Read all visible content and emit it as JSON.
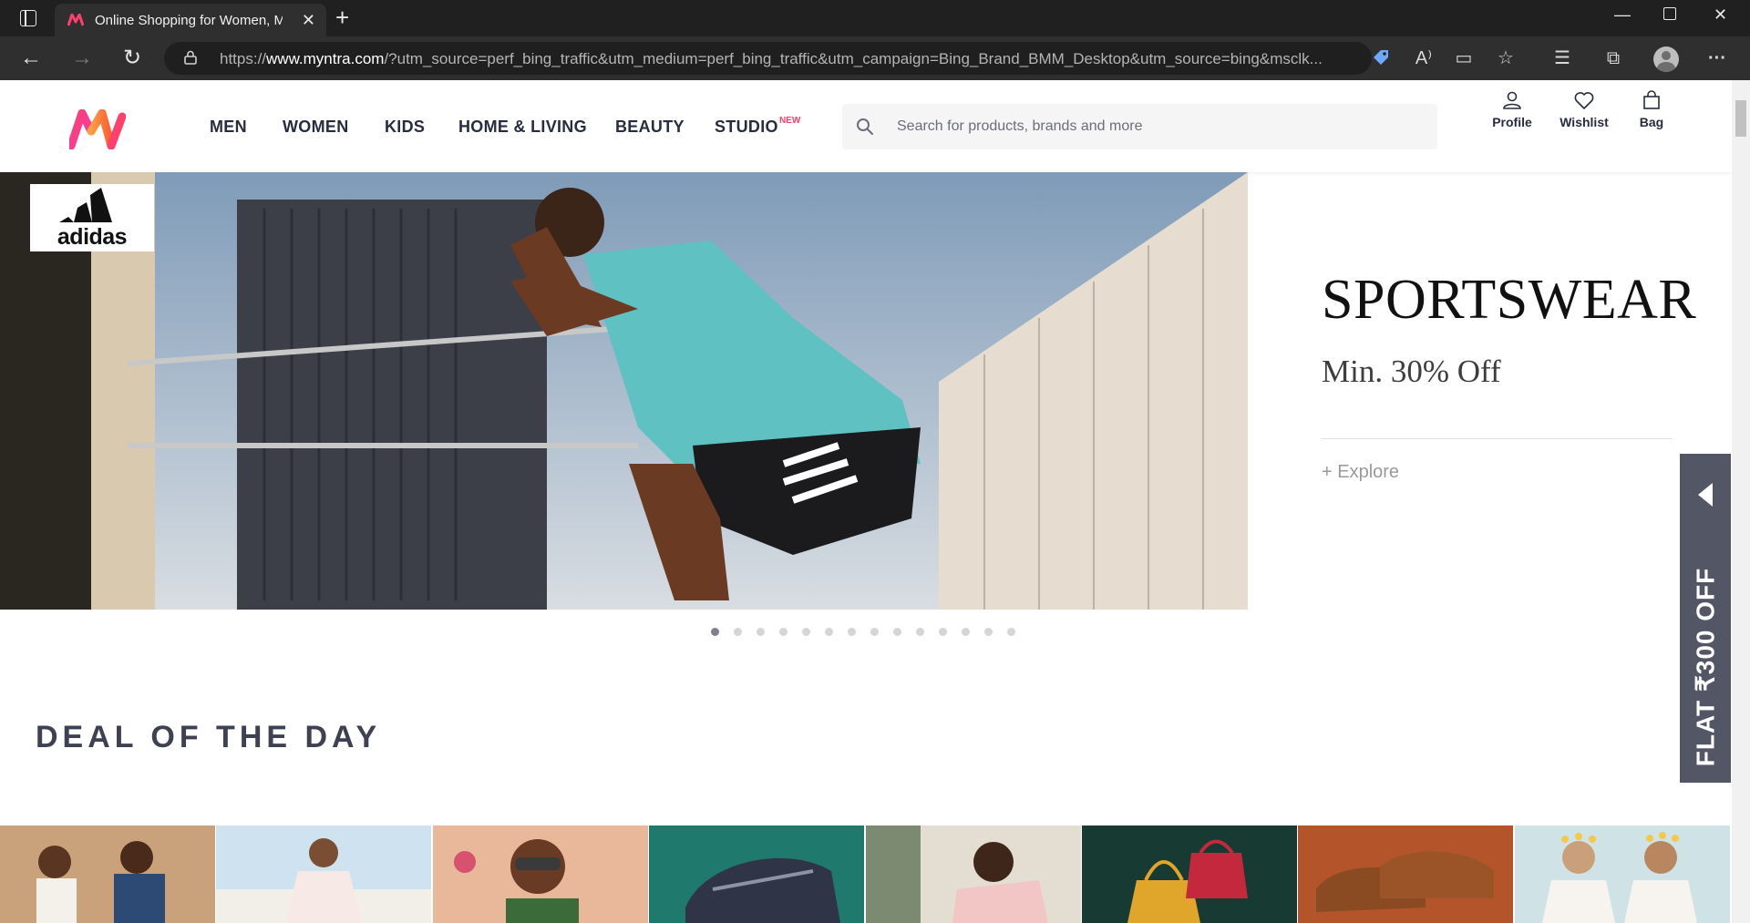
{
  "browser": {
    "tab_title": "Online Shopping for Women, Men",
    "url_prefix": "https://",
    "url_host": "www.myntra.com",
    "url_rest": "/?utm_source=perf_bing_traffic&utm_medium=perf_bing_traffic&utm_campaign=Bing_Brand_BMM_Desktop&utm_source=bing&msclk...",
    "icons": [
      "sidebar-icon",
      "close-icon",
      "plus-icon",
      "minimize-icon",
      "maximize-icon",
      "back-icon",
      "forward-icon",
      "refresh-icon",
      "lock-icon",
      "tag-icon",
      "read-aloud-icon",
      "immersive-reader-icon",
      "favorite-add-icon",
      "favorites-icon",
      "collections-icon",
      "profile-icon",
      "more-icon"
    ]
  },
  "header": {
    "nav": [
      "MEN",
      "WOMEN",
      "KIDS",
      "HOME & LIVING",
      "BEAUTY",
      "STUDIO"
    ],
    "studio_badge": "NEW",
    "search_placeholder": "Search for products, brands and more",
    "actions": [
      "Profile",
      "Wishlist",
      "Bag"
    ]
  },
  "hero": {
    "brand": "adidas",
    "title": "SPORTSWEAR",
    "subtitle": "Min. 30% Off",
    "cta": "+ Explore",
    "slide_count": 14,
    "active_slide": 1
  },
  "offer_tab": {
    "label": "FLAT ₹300 OFF"
  },
  "deals": {
    "title": "DEAL OF THE DAY",
    "card_count": 8
  },
  "colors": {
    "accent": "#ff3f6c",
    "nav_text": "#282c3f",
    "offer_bg": "#535665"
  }
}
